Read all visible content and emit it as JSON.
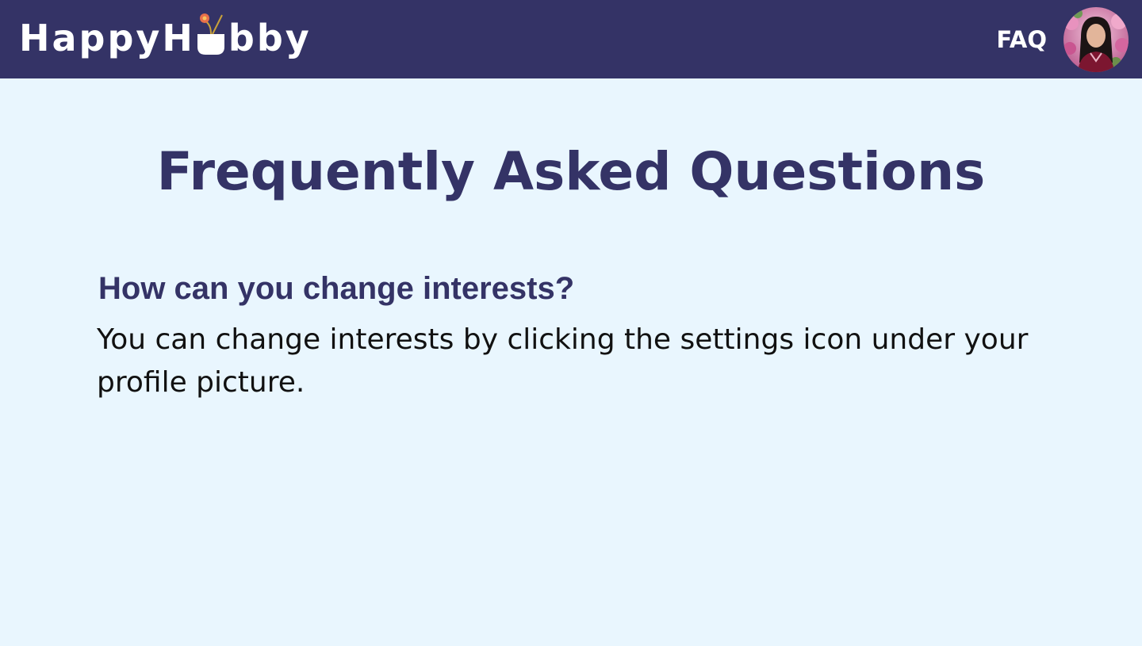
{
  "header": {
    "logo_text_before": "HappyH",
    "logo_text_after": "bby",
    "nav_faq": "FAQ",
    "colors": {
      "bar": "#343366",
      "text": "#ffffff"
    },
    "avatar_alt": "",
    "logo_icon": "plant-pot-icon"
  },
  "main": {
    "title": "Frequently Asked Questions",
    "faq": [
      {
        "question": "How can you change interests?",
        "answer": "You can change interests by clicking the settings icon under your profile picture."
      }
    ],
    "colors": {
      "background": "#e9f6fe",
      "heading": "#343366",
      "body": "#111111"
    }
  }
}
